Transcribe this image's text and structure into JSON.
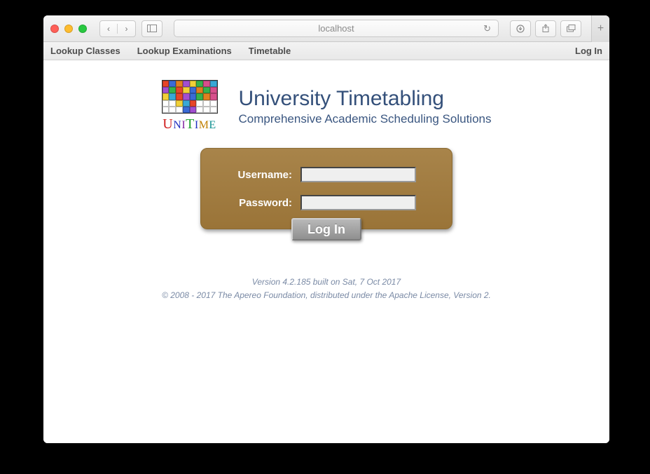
{
  "browser": {
    "address": "localhost"
  },
  "menubar": {
    "items": [
      "Lookup Classes",
      "Lookup Examinations",
      "Timetable"
    ],
    "right": "Log In"
  },
  "header": {
    "logo_word": "UniTime",
    "title": "University Timetabling",
    "subtitle": "Comprehensive Academic Scheduling Solutions"
  },
  "login": {
    "username_label": "Username:",
    "password_label": "Password:",
    "username_value": "",
    "password_value": "",
    "submit_label": "Log In"
  },
  "footer": {
    "version": "Version 4.2.185 built on Sat, 7 Oct 2017",
    "copyright": "© 2008 - 2017 The Apereo Foundation, distributed under the Apache License, Version 2."
  },
  "logo_colors": [
    "#e64528",
    "#3a6bd6",
    "#e07f1f",
    "#a24fd0",
    "#f0d038",
    "#36b24c",
    "#d84f8c",
    "#3aa8d6",
    "#a24fd0",
    "#36b24c",
    "#e64528",
    "#f0d038",
    "#3a6bd6",
    "#e07f1f",
    "#36b24c",
    "#d84f8c",
    "#f0d038",
    "#3aa8d6",
    "#e64528",
    "#a24fd0",
    "#3a6bd6",
    "#36b24c",
    "#e07f1f",
    "#d84f8c",
    "#ffffff",
    "#ffffff",
    "#f0d038",
    "#3aa8d6",
    "#e64528",
    "#ffffff",
    "#ffffff",
    "#ffffff",
    "#ffffff",
    "#ffffff",
    "#ffffff",
    "#3a6bd6",
    "#a24fd0",
    "#ffffff",
    "#ffffff",
    "#ffffff"
  ]
}
